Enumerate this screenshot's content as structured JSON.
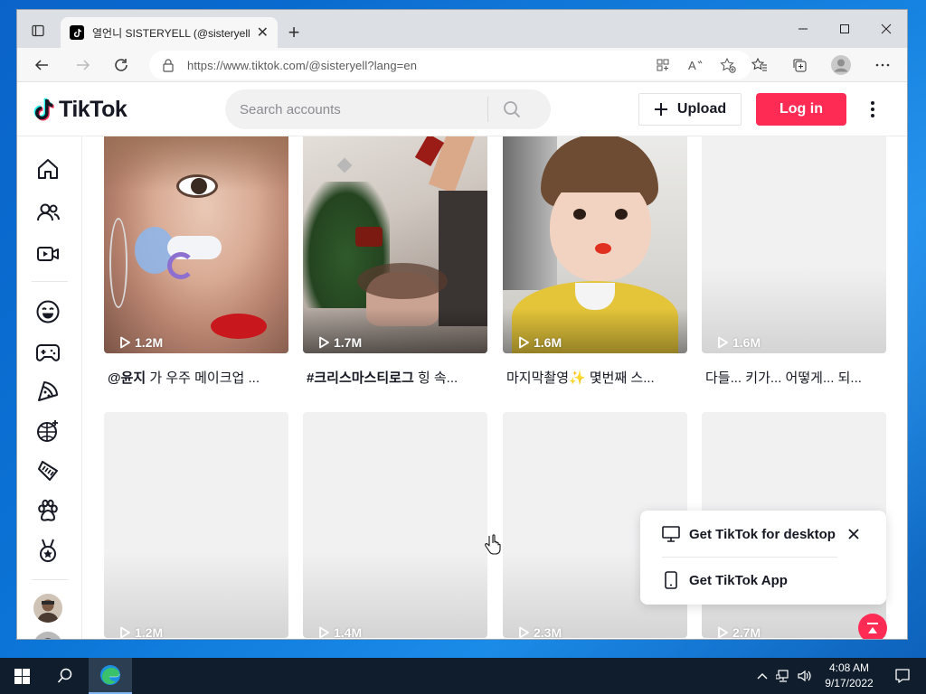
{
  "browser": {
    "tab_title": "열언니 SISTERYELL (@sisteryell) | TikTok",
    "url": "https://www.tiktok.com/@sisteryell?lang=en"
  },
  "tiktok": {
    "logo_text": "TikTok",
    "search": {
      "placeholder": "Search accounts"
    },
    "upload_label": "Upload",
    "login_label": "Log in",
    "brand_color": "#fe2c55"
  },
  "sidenav": {
    "icons": [
      "home-icon",
      "following-icon",
      "live-icon",
      "comedy-icon",
      "gaming-icon",
      "food-icon",
      "dance-icon",
      "beauty-icon",
      "animals-icon",
      "sports-icon"
    ]
  },
  "videos": [
    {
      "views": "1.2M",
      "caption_bold": "@윤지",
      "caption": " 가 우주 메이크업 ..."
    },
    {
      "views": "1.7M",
      "caption_bold": "#크리스마스티로그",
      "caption": " 힝 속..."
    },
    {
      "views": "1.6M",
      "caption_bold": "",
      "caption": "마지막촬영✨ 몇번째 스..."
    },
    {
      "views": "1.6M",
      "caption_bold": "",
      "caption": "다들... 키가... 어떻게... 되..."
    },
    {
      "views": "1.2M",
      "caption_bold": "",
      "caption": ""
    },
    {
      "views": "1.4M",
      "caption_bold": "",
      "caption": ""
    },
    {
      "views": "2.3M",
      "caption_bold": "",
      "caption": ""
    },
    {
      "views": "2.7M",
      "caption_bold": "",
      "caption": ""
    }
  ],
  "get_app_popup": {
    "desktop_label": "Get TikTok for desktop",
    "app_label": "Get TikTok App"
  },
  "taskbar": {
    "time": "4:08 AM",
    "date": "9/17/2022"
  }
}
